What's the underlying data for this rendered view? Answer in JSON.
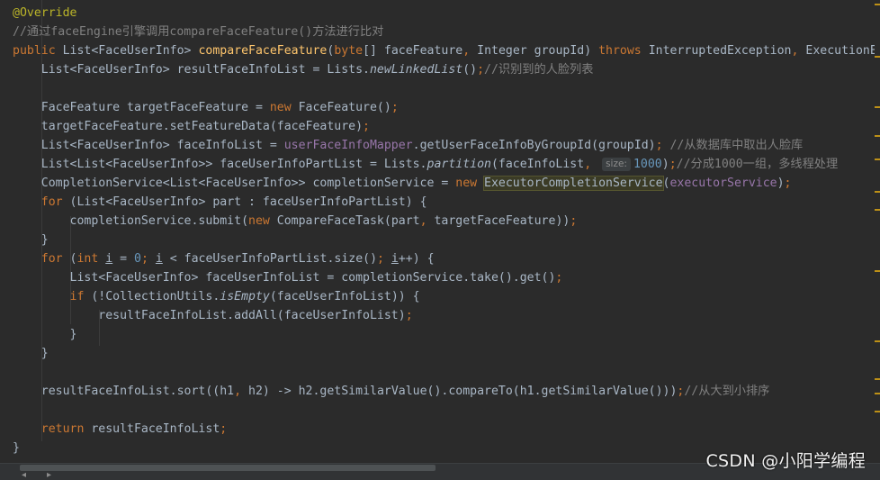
{
  "editor": {
    "lines": [
      {
        "tokens": [
          {
            "c": "ann",
            "t": "@Override"
          }
        ]
      },
      {
        "tokens": [
          {
            "c": "cmt",
            "t": "//通过faceEngine引擎调用compareFaceFeature()方法进行比对"
          }
        ]
      },
      {
        "tokens": [
          {
            "c": "kw",
            "t": "public "
          },
          {
            "c": "plain",
            "t": "List<FaceUserInfo> "
          },
          {
            "c": "fn",
            "t": "compareFaceFeature"
          },
          {
            "c": "plain",
            "t": "("
          },
          {
            "c": "kw",
            "t": "byte"
          },
          {
            "c": "plain",
            "t": "[] faceFeature"
          },
          {
            "c": "kw",
            "t": ", "
          },
          {
            "c": "plain",
            "t": "Integer groupId) "
          },
          {
            "c": "kw",
            "t": "throws "
          },
          {
            "c": "plain",
            "t": "InterruptedException"
          },
          {
            "c": "kw",
            "t": ", "
          },
          {
            "c": "plain",
            "t": "ExecutionException {"
          }
        ]
      },
      {
        "tokens": [
          {
            "c": "plain",
            "t": "    List<FaceUserInfo> resultFaceInfoList = Lists."
          },
          {
            "c": "static",
            "t": "newLinkedList"
          },
          {
            "c": "plain",
            "t": "()"
          },
          {
            "c": "kw",
            "t": ";"
          },
          {
            "c": "cmt",
            "t": "//识别到的人脸列表"
          }
        ]
      },
      {
        "tokens": []
      },
      {
        "tokens": [
          {
            "c": "plain",
            "t": "    FaceFeature targetFaceFeature = "
          },
          {
            "c": "kw",
            "t": "new "
          },
          {
            "c": "plain",
            "t": "FaceFeature()"
          },
          {
            "c": "kw",
            "t": ";"
          }
        ]
      },
      {
        "tokens": [
          {
            "c": "plain",
            "t": "    targetFaceFeature.setFeatureData(faceFeature)"
          },
          {
            "c": "kw",
            "t": ";"
          }
        ]
      },
      {
        "tokens": [
          {
            "c": "plain",
            "t": "    List<FaceUserInfo> faceInfoList = "
          },
          {
            "c": "field",
            "t": "userFaceInfoMapper"
          },
          {
            "c": "plain",
            "t": ".getUserFaceInfoByGroupId(groupId)"
          },
          {
            "c": "kw",
            "t": "; "
          },
          {
            "c": "cmt",
            "t": "//从数据库中取出人脸库"
          }
        ]
      },
      {
        "tokens": [
          {
            "c": "plain",
            "t": "    List<List<FaceUserInfo>> faceUserInfoPartList = Lists."
          },
          {
            "c": "static",
            "t": "partition"
          },
          {
            "c": "plain",
            "t": "(faceInfoList"
          },
          {
            "c": "kw",
            "t": ", "
          },
          {
            "c": "hint",
            "t": "size:"
          },
          {
            "c": "num",
            "t": "1000"
          },
          {
            "c": "plain",
            "t": ")"
          },
          {
            "c": "kw",
            "t": ";"
          },
          {
            "c": "cmt",
            "t": "//分成1000一组，多线程处理"
          }
        ]
      },
      {
        "tokens": [
          {
            "c": "plain",
            "t": "    CompletionService<List<FaceUserInfo>> completionService = "
          },
          {
            "c": "kw",
            "t": "new "
          },
          {
            "c": "hl",
            "t": "ExecutorCompletionService"
          },
          {
            "c": "plain",
            "t": "("
          },
          {
            "c": "field",
            "t": "executorService"
          },
          {
            "c": "plain",
            "t": ")"
          },
          {
            "c": "kw",
            "t": ";"
          }
        ]
      },
      {
        "tokens": [
          {
            "c": "kw",
            "t": "    for "
          },
          {
            "c": "plain",
            "t": "(List<FaceUserInfo> part : faceUserInfoPartList) {"
          }
        ]
      },
      {
        "tokens": [
          {
            "c": "plain",
            "t": "        completionService.submit("
          },
          {
            "c": "kw",
            "t": "new "
          },
          {
            "c": "plain",
            "t": "CompareFaceTask(part"
          },
          {
            "c": "kw",
            "t": ", "
          },
          {
            "c": "plain",
            "t": "targetFaceFeature))"
          },
          {
            "c": "kw",
            "t": ";"
          }
        ]
      },
      {
        "tokens": [
          {
            "c": "plain",
            "t": "    }"
          }
        ]
      },
      {
        "tokens": [
          {
            "c": "kw",
            "t": "    for "
          },
          {
            "c": "plain",
            "t": "("
          },
          {
            "c": "kw",
            "t": "int "
          },
          {
            "c": "ul",
            "t": "i"
          },
          {
            "c": "plain",
            "t": " = "
          },
          {
            "c": "num",
            "t": "0"
          },
          {
            "c": "kw",
            "t": "; "
          },
          {
            "c": "ul",
            "t": "i"
          },
          {
            "c": "plain",
            "t": " < faceUserInfoPartList.size()"
          },
          {
            "c": "kw",
            "t": "; "
          },
          {
            "c": "ul",
            "t": "i"
          },
          {
            "c": "plain",
            "t": "++) {"
          }
        ]
      },
      {
        "tokens": [
          {
            "c": "plain",
            "t": "        List<FaceUserInfo> faceUserInfoList = completionService.take().get()"
          },
          {
            "c": "kw",
            "t": ";"
          }
        ]
      },
      {
        "tokens": [
          {
            "c": "kw",
            "t": "        if "
          },
          {
            "c": "plain",
            "t": "(!CollectionUtils."
          },
          {
            "c": "static",
            "t": "isEmpty"
          },
          {
            "c": "plain",
            "t": "(faceUserInfoList)) {"
          }
        ]
      },
      {
        "tokens": [
          {
            "c": "plain",
            "t": "            resultFaceInfoList.addAll(faceUserInfoList)"
          },
          {
            "c": "kw",
            "t": ";"
          }
        ]
      },
      {
        "tokens": [
          {
            "c": "plain",
            "t": "        }"
          }
        ]
      },
      {
        "tokens": [
          {
            "c": "plain",
            "t": "    }"
          }
        ]
      },
      {
        "tokens": []
      },
      {
        "tokens": [
          {
            "c": "plain",
            "t": "    resultFaceInfoList.sort((h1"
          },
          {
            "c": "kw",
            "t": ", "
          },
          {
            "c": "plain",
            "t": "h2) -> h2.getSimilarValue().compareTo(h1.getSimilarValue()))"
          },
          {
            "c": "kw",
            "t": ";"
          },
          {
            "c": "cmt",
            "t": "//从大到小排序"
          }
        ]
      },
      {
        "tokens": []
      },
      {
        "tokens": [
          {
            "c": "kw",
            "t": "    return "
          },
          {
            "c": "plain",
            "t": "resultFaceInfoList"
          },
          {
            "c": "kw",
            "t": ";"
          }
        ]
      },
      {
        "tokens": [
          {
            "c": "plain",
            "t": "}"
          }
        ]
      }
    ]
  },
  "colors": {
    "background": "#2b2b2b",
    "keyword": "#cc7832",
    "annotation": "#bbb529",
    "comment": "#808080",
    "number": "#6897bb",
    "method_declaration": "#ffc66d",
    "field": "#9876aa",
    "default_text": "#a9b7c6",
    "gutter_mark": "#be9117"
  },
  "watermark": {
    "text": "CSDN @小阳学编程"
  },
  "scrollbar": {
    "left_icon": "chevron-left-icon",
    "right_icon": "chevron-right-icon"
  }
}
